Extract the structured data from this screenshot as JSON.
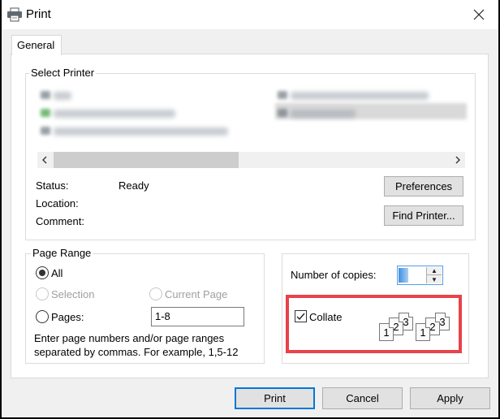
{
  "window": {
    "title": "Print",
    "title_icon": "printer-icon",
    "close_icon": "close-icon"
  },
  "tabs": [
    {
      "label": "General",
      "active": true
    }
  ],
  "select_printer": {
    "legend": "Select Printer",
    "printers_obscured": true,
    "scroll_left_icon": "chevron-left-icon",
    "scroll_right_icon": "chevron-right-icon",
    "status_label": "Status:",
    "status_value": "Ready",
    "location_label": "Location:",
    "location_value": "",
    "comment_label": "Comment:",
    "comment_value": "",
    "preferences_label": "Preferences",
    "find_printer_label": "Find Printer..."
  },
  "page_range": {
    "legend": "Page Range",
    "options": {
      "all": {
        "label": "All",
        "checked": true,
        "disabled": false
      },
      "selection": {
        "label": "Selection",
        "checked": false,
        "disabled": true
      },
      "current_page": {
        "label": "Current Page",
        "checked": false,
        "disabled": true
      },
      "pages": {
        "label": "Pages:",
        "checked": false,
        "disabled": false
      }
    },
    "pages_value": "1-8",
    "hint_line1": "Enter page numbers and/or page ranges",
    "hint_line2": "separated by commas.  For example, 1,5-12"
  },
  "copies": {
    "label": "Number of copies:",
    "value": "",
    "collate_label": "Collate",
    "collate_checked": true,
    "collate_pages": [
      "1",
      "2",
      "3"
    ],
    "highlight_color": "#e8424a"
  },
  "footer": {
    "print_label": "Print",
    "cancel_label": "Cancel",
    "apply_label": "Apply"
  }
}
